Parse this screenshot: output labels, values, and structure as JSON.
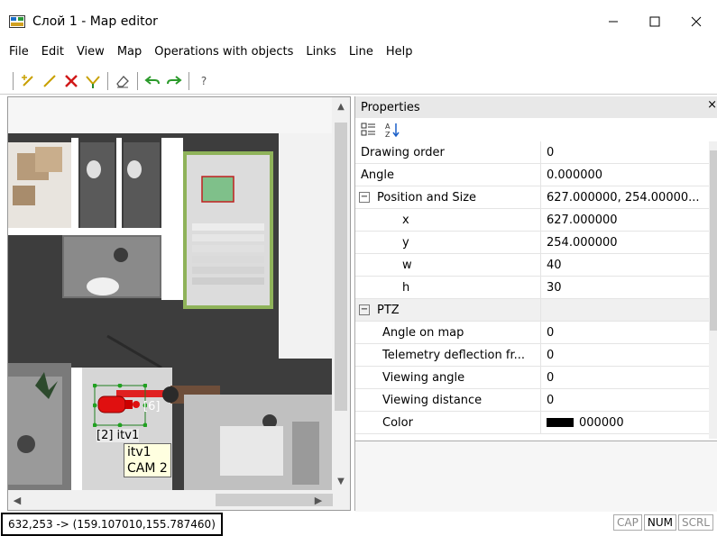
{
  "window": {
    "title": "Слой 1 - Map editor"
  },
  "menu": [
    "File",
    "Edit",
    "View",
    "Map",
    "Operations with objects",
    "Links",
    "Line",
    "Help"
  ],
  "toolbar": {
    "buttons": [
      "add-object-icon",
      "draw-line-icon",
      "delete-icon",
      "move-icon",
      "eraser-icon",
      "undo-icon",
      "redo-icon",
      "help-icon"
    ],
    "help_label": "?"
  },
  "map": {
    "camera_label": "[2] itv1",
    "tooltip_line1": "itv1",
    "tooltip_line2": "CAM 2",
    "partial_label": "[6]",
    "colors": {
      "camera": "#e01010",
      "floor_dark": "#3c3c3c",
      "wall": "#ffffff"
    }
  },
  "properties": {
    "title": "Properties",
    "close": "×",
    "rows": [
      {
        "name": "Drawing order",
        "value": "0",
        "type": "prop"
      },
      {
        "name": "Angle",
        "value": "0.000000",
        "type": "prop"
      },
      {
        "name": "Position and Size",
        "value": "627.000000, 254.00000...",
        "type": "cat"
      },
      {
        "name": "x",
        "value": "627.000000",
        "type": "sub"
      },
      {
        "name": "y",
        "value": "254.000000",
        "type": "sub"
      },
      {
        "name": "w",
        "value": "40",
        "type": "sub"
      },
      {
        "name": "h",
        "value": "30",
        "type": "sub"
      },
      {
        "name": "PTZ",
        "value": "",
        "type": "cat"
      },
      {
        "name": "Angle on map",
        "value": "0",
        "type": "sub1"
      },
      {
        "name": "Telemetry deflection fr...",
        "value": "0",
        "type": "sub1"
      },
      {
        "name": "Viewing angle",
        "value": "0",
        "type": "sub1"
      },
      {
        "name": "Viewing distance",
        "value": "0",
        "type": "sub1"
      },
      {
        "name": "Color",
        "value": "000000",
        "type": "sub1"
      }
    ]
  },
  "status": {
    "coords": "632,253 -> (159.107010,155.787460)",
    "indicators": [
      {
        "label": "CAP",
        "active": false
      },
      {
        "label": "NUM",
        "active": true
      },
      {
        "label": "SCRL",
        "active": false
      }
    ]
  }
}
